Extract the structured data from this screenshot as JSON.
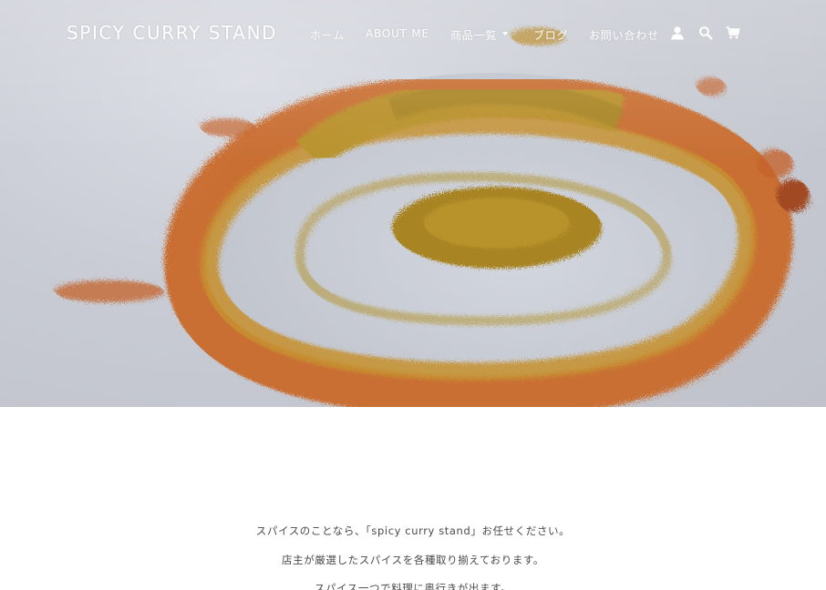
{
  "header": {
    "logo": "SPICY CURRY STAND",
    "nav": {
      "home": "ホーム",
      "about": "ABOUT ME",
      "products": "商品一覧",
      "blog": "ブログ",
      "contact": "お問い合わせ"
    },
    "icons": {
      "account": "user-icon",
      "search": "search-icon",
      "cart": "cart-icon"
    }
  },
  "hero": {
    "image": "spice-powder-swirl"
  },
  "intro": {
    "line1": "スパイスのことなら、「spicy curry stand」お任せください。",
    "line2": "店主が厳選したスパイスを各種取り揃えております。",
    "line3": "スパイス一つで料理に奥行きが出ます。"
  },
  "colors": {
    "header_text": "#ffffff",
    "body_text": "#4a4a4a",
    "background": "#ffffff"
  }
}
